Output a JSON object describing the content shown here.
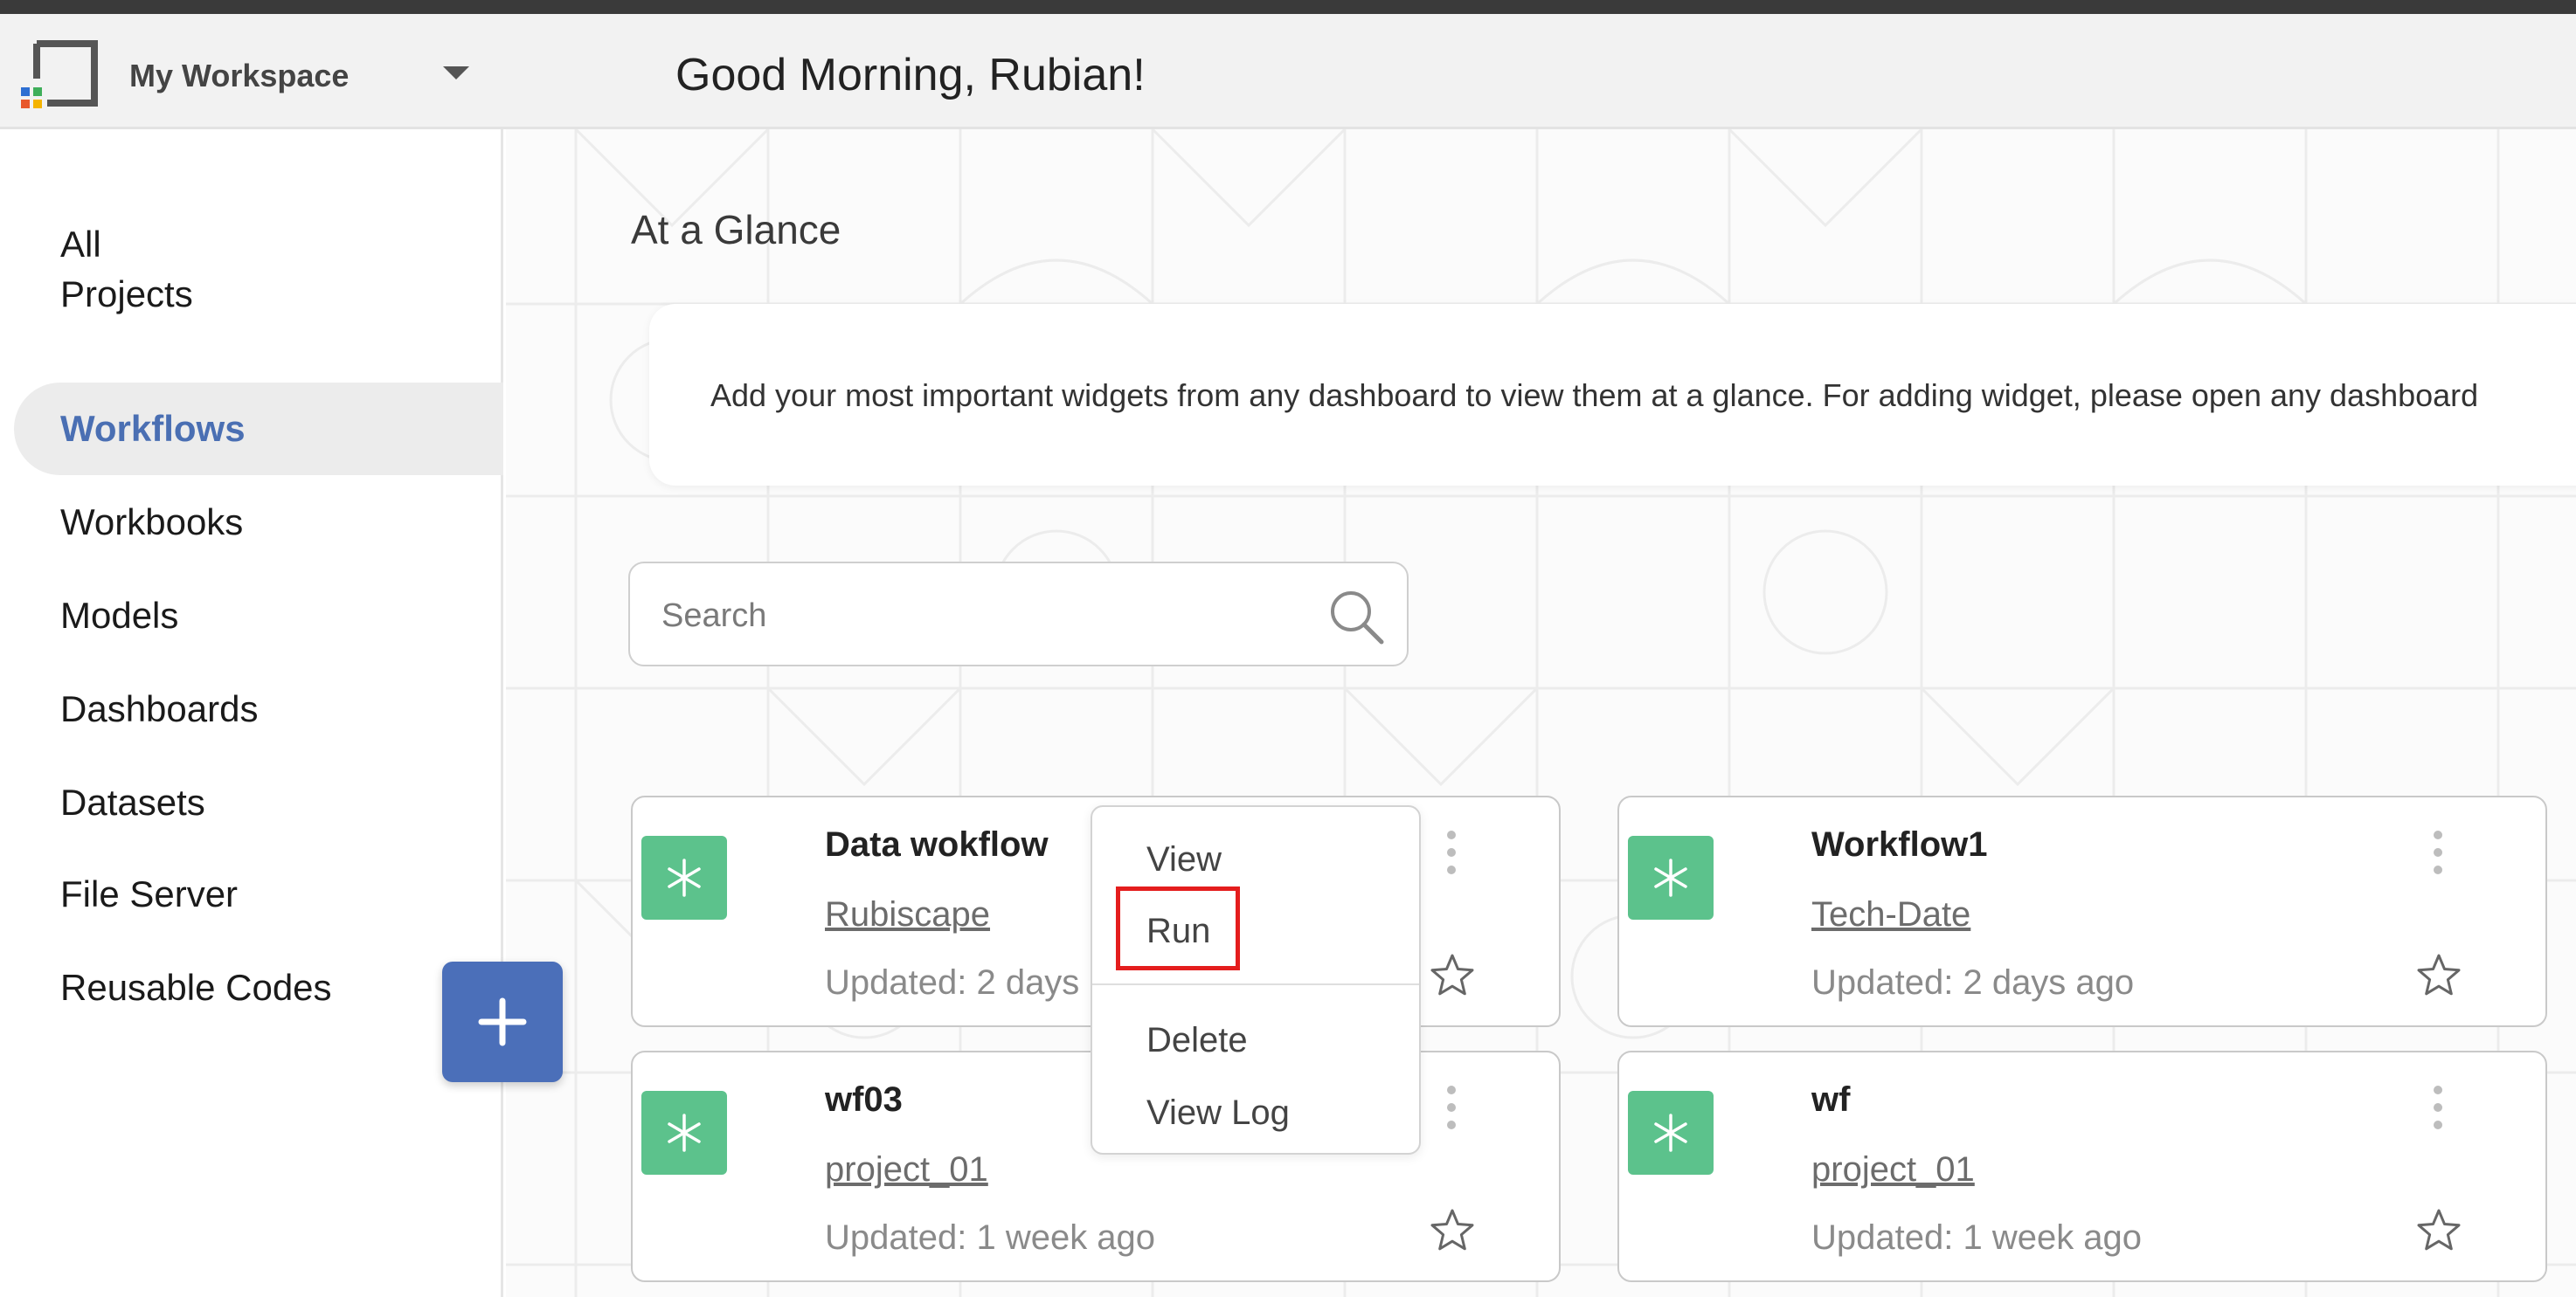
{
  "header": {
    "workspace_name": "My Workspace",
    "greeting": "Good Morning, Rubian!"
  },
  "sidebar": {
    "items": [
      {
        "label": "All",
        "active": false
      },
      {
        "label": "Projects",
        "active": false
      },
      {
        "label": "Workflows",
        "active": true
      },
      {
        "label": "Workbooks",
        "active": false
      },
      {
        "label": "Models",
        "active": false
      },
      {
        "label": "Dashboards",
        "active": false
      },
      {
        "label": "Datasets",
        "active": false
      },
      {
        "label": "File Server",
        "active": false
      },
      {
        "label": "Reusable Codes",
        "active": false
      }
    ]
  },
  "main": {
    "section_title": "At a Glance",
    "glance_message": "Add your most important widgets from any dashboard to view them at a glance. For adding widget, please open any dashboard",
    "search": {
      "placeholder": "Search",
      "value": ""
    }
  },
  "workflows": [
    {
      "title": "Data wokflow",
      "project": "Rubiscape",
      "updated": "Updated: 2 days ago"
    },
    {
      "title": "Workflow1",
      "project": "Tech-Date",
      "updated": "Updated: 2 days ago"
    },
    {
      "title": "wf03",
      "project": "project_01",
      "updated": "Updated: 1 week ago"
    },
    {
      "title": "wf",
      "project": "project_01",
      "updated": "Updated: 1 week ago"
    }
  ],
  "context_menu": {
    "items": [
      "View",
      "Run",
      "Delete",
      "View Log"
    ],
    "highlighted": "Run"
  },
  "colors": {
    "accent": "#4a6fb3",
    "workflow_icon": "#5cc28c",
    "highlight": "#e41d1d",
    "fab": "#4b6fb9"
  },
  "icons": {
    "logo": "rubiscape-logo",
    "workflow": "asterisk-icon",
    "search": "search-icon",
    "favorite": "star-icon",
    "more": "kebab-menu-icon",
    "add": "plus-icon"
  }
}
